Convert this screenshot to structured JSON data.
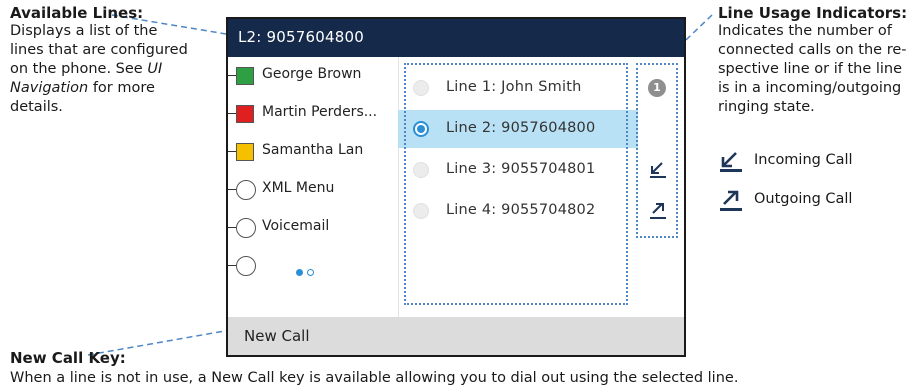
{
  "callouts": {
    "available_lines": {
      "title": "Available Lines:",
      "body_line1": "Displays a list of the",
      "body_line2": "lines that are configured",
      "body_line3": "on the phone. See ",
      "body_line3_italic": "UI",
      "body_line4_italic": "Navigation",
      "body_line4": " for more",
      "body_line5": "details."
    },
    "line_usage": {
      "title": "Line Usage Indicators:",
      "body_lines": [
        "Indicates the number of",
        "connected calls on the re-",
        "spective line or if the line",
        "is in a incoming/outgoing",
        "ringing state."
      ],
      "legend": [
        {
          "icon": "incoming-call-icon",
          "label": "Incoming Call"
        },
        {
          "icon": "outgoing-call-icon",
          "label": "Outgoing Call"
        }
      ]
    },
    "new_call_key": {
      "title": "New Call Key:",
      "body": "When a line is not in use, a New Call key is available allowing you to dial out using the selected line."
    }
  },
  "phone": {
    "header": "L2: 9057604800",
    "soft_key": "New Call",
    "keys": [
      {
        "label": "George Brown",
        "type": "square",
        "color": "#2ea043"
      },
      {
        "label": "Martin Perders...",
        "type": "square",
        "color": "#e02020"
      },
      {
        "label": "Samantha Lan",
        "type": "square",
        "color": "#f5c000"
      },
      {
        "label": "XML Menu",
        "type": "circle"
      },
      {
        "label": "Voicemail",
        "type": "circle"
      },
      {
        "label": "",
        "type": "circle"
      }
    ],
    "page_dots": {
      "current": 1,
      "total": 2
    },
    "lines": [
      {
        "label": "Line 1: John Smith",
        "selected": false,
        "indicator": "1"
      },
      {
        "label": "Line 2: 9057604800",
        "selected": true,
        "indicator": ""
      },
      {
        "label": "Line 3: 9055704801",
        "selected": false,
        "indicator": "incoming-call-icon"
      },
      {
        "label": "Line 4: 9055704802",
        "selected": false,
        "indicator": "outgoing-call-icon"
      }
    ]
  },
  "colors": {
    "header_bg": "#15294a",
    "selected_row": "#b9e1f5",
    "accent_blue": "#2b8fd6",
    "leader_blue": "#4f86c6",
    "icon_navy": "#1d3557"
  }
}
